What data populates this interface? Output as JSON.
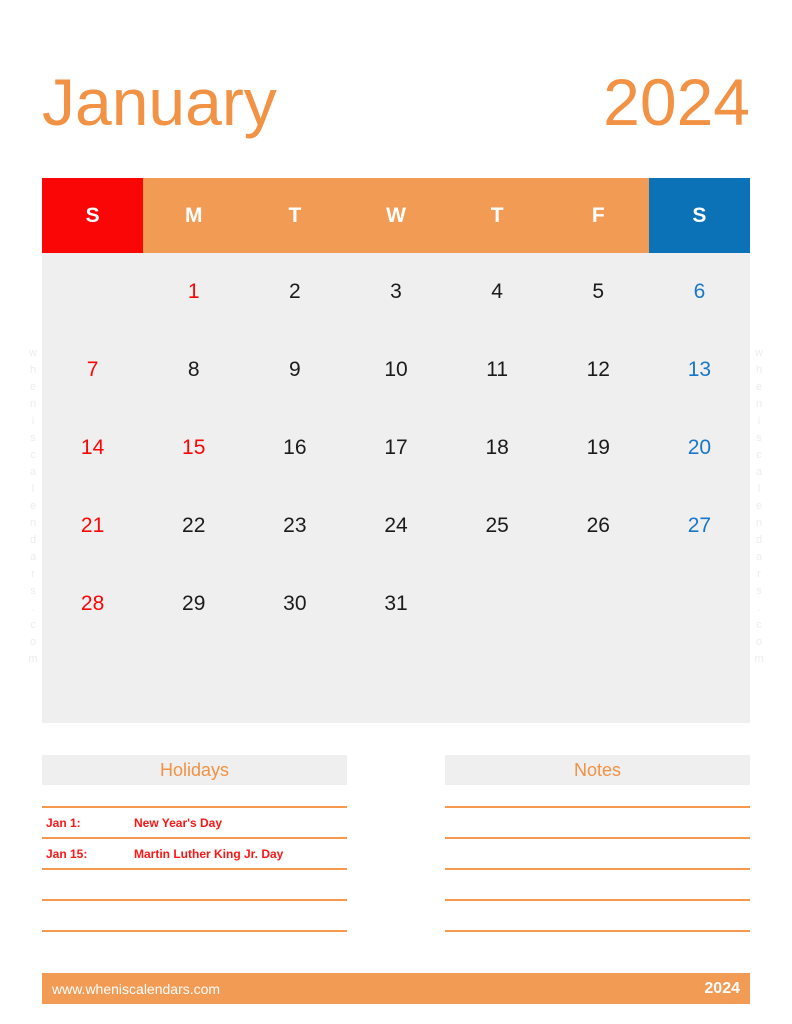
{
  "title": {
    "month": "January",
    "year": "2024"
  },
  "calendar": {
    "weekdays": [
      {
        "label": "S",
        "kind": "sun"
      },
      {
        "label": "M",
        "kind": "weekday"
      },
      {
        "label": "T",
        "kind": "weekday"
      },
      {
        "label": "W",
        "kind": "weekday"
      },
      {
        "label": "T",
        "kind": "weekday"
      },
      {
        "label": "F",
        "kind": "weekday"
      },
      {
        "label": "S",
        "kind": "sat"
      }
    ],
    "weeks": [
      [
        {
          "label": "",
          "kind": "empty"
        },
        {
          "label": "1",
          "kind": "holiday"
        },
        {
          "label": "2",
          "kind": "weekday"
        },
        {
          "label": "3",
          "kind": "weekday"
        },
        {
          "label": "4",
          "kind": "weekday"
        },
        {
          "label": "5",
          "kind": "weekday"
        },
        {
          "label": "6",
          "kind": "sat"
        }
      ],
      [
        {
          "label": "7",
          "kind": "sun"
        },
        {
          "label": "8",
          "kind": "weekday"
        },
        {
          "label": "9",
          "kind": "weekday"
        },
        {
          "label": "10",
          "kind": "weekday"
        },
        {
          "label": "11",
          "kind": "weekday"
        },
        {
          "label": "12",
          "kind": "weekday"
        },
        {
          "label": "13",
          "kind": "sat"
        }
      ],
      [
        {
          "label": "14",
          "kind": "sun"
        },
        {
          "label": "15",
          "kind": "holiday"
        },
        {
          "label": "16",
          "kind": "weekday"
        },
        {
          "label": "17",
          "kind": "weekday"
        },
        {
          "label": "18",
          "kind": "weekday"
        },
        {
          "label": "19",
          "kind": "weekday"
        },
        {
          "label": "20",
          "kind": "sat"
        }
      ],
      [
        {
          "label": "21",
          "kind": "sun"
        },
        {
          "label": "22",
          "kind": "weekday"
        },
        {
          "label": "23",
          "kind": "weekday"
        },
        {
          "label": "24",
          "kind": "weekday"
        },
        {
          "label": "25",
          "kind": "weekday"
        },
        {
          "label": "26",
          "kind": "weekday"
        },
        {
          "label": "27",
          "kind": "sat"
        }
      ],
      [
        {
          "label": "28",
          "kind": "sun"
        },
        {
          "label": "29",
          "kind": "weekday"
        },
        {
          "label": "30",
          "kind": "weekday"
        },
        {
          "label": "31",
          "kind": "weekday"
        },
        {
          "label": "",
          "kind": "empty"
        },
        {
          "label": "",
          "kind": "empty"
        },
        {
          "label": "",
          "kind": "empty"
        }
      ],
      [
        {
          "label": "",
          "kind": "empty"
        },
        {
          "label": "",
          "kind": "empty"
        },
        {
          "label": "",
          "kind": "empty"
        },
        {
          "label": "",
          "kind": "empty"
        },
        {
          "label": "",
          "kind": "empty"
        },
        {
          "label": "",
          "kind": "empty"
        },
        {
          "label": "",
          "kind": "empty"
        }
      ]
    ]
  },
  "holidays": {
    "heading": "Holidays",
    "entries": [
      {
        "date": "Jan 1:",
        "name": "New Year's Day"
      },
      {
        "date": "Jan 15:",
        "name": "Martin Luther King Jr. Day"
      },
      {
        "date": "",
        "name": ""
      },
      {
        "date": "",
        "name": ""
      }
    ]
  },
  "notes": {
    "heading": "Notes",
    "lines": [
      "",
      "",
      "",
      ""
    ]
  },
  "footer": {
    "url": "www.wheniscalendars.com",
    "year": "2024"
  },
  "watermark": {
    "text": "wheniscalendars.com"
  },
  "colors": {
    "accent_orange": "#F29244",
    "header_orange": "#F29B54",
    "sunday_red": "#FB0606",
    "saturday_blue": "#0C72B8",
    "grid_background": "#EFEFEF",
    "line_orange": "#F6994E"
  }
}
